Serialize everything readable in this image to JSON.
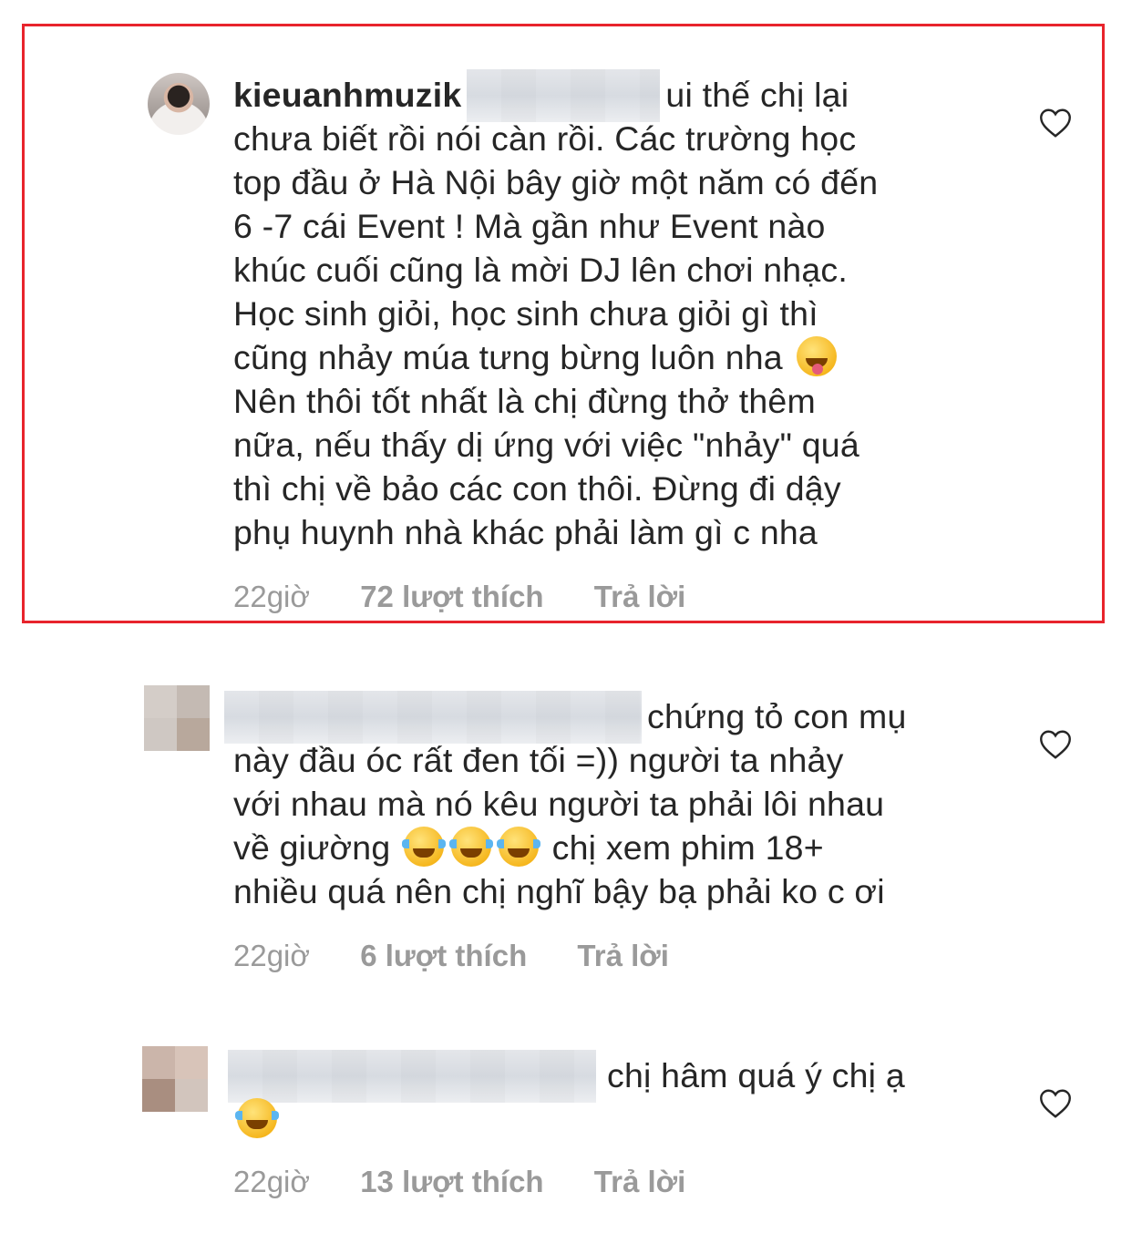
{
  "comments": [
    {
      "username": "kieuanhmuzik",
      "text_lines": [
        "ui thế chị lại",
        "chưa biết rồi nói càn rồi. Các trường học",
        "top đầu ở Hà Nội bây giờ một năm có đến",
        "6 -7 cái Event ! Mà gần như Event nào",
        "khúc cuối cũng là mời DJ lên chơi nhạc.",
        "Học sinh giỏi, học sinh chưa giỏi gì thì",
        "cũng nhảy múa tưng bừng luôn nha",
        "Nên thôi tốt nhất là chị đừng thở thêm",
        "nữa, nếu thấy dị ứng với việc \"nhảy\" quá",
        "thì chị về bảo các con thôi. Đừng đi dậy",
        "phụ huynh nhà khác phải làm gì c nha"
      ],
      "emoji": "winking-tongue-emoji",
      "time": "22giờ",
      "likes": "72 lượt thích",
      "reply": "Trả lời",
      "highlighted": true,
      "highlight_color": "#e8242c"
    },
    {
      "text_lines": [
        "chứng tỏ con mụ",
        "này đầu óc rất đen tối =)) người ta nhảy",
        "với nhau mà nó kêu người ta phải lôi nhau",
        "về giường",
        "chị xem phim 18+",
        "nhiều quá nên chị nghĩ bậy bạ phải ko c ơi"
      ],
      "emoji": "tears-of-joy-emoji",
      "time": "22giờ",
      "likes": "6 lượt thích",
      "reply": "Trả lời"
    },
    {
      "text_lines": [
        "chị hâm quá ý chị ạ"
      ],
      "emoji": "rolling-laughing-emoji",
      "time": "22giờ",
      "likes": "13 lượt thích",
      "reply": "Trả lời"
    }
  ],
  "colors": {
    "text": "#262626",
    "meta": "#9a9a9a",
    "heart": "#262626"
  }
}
